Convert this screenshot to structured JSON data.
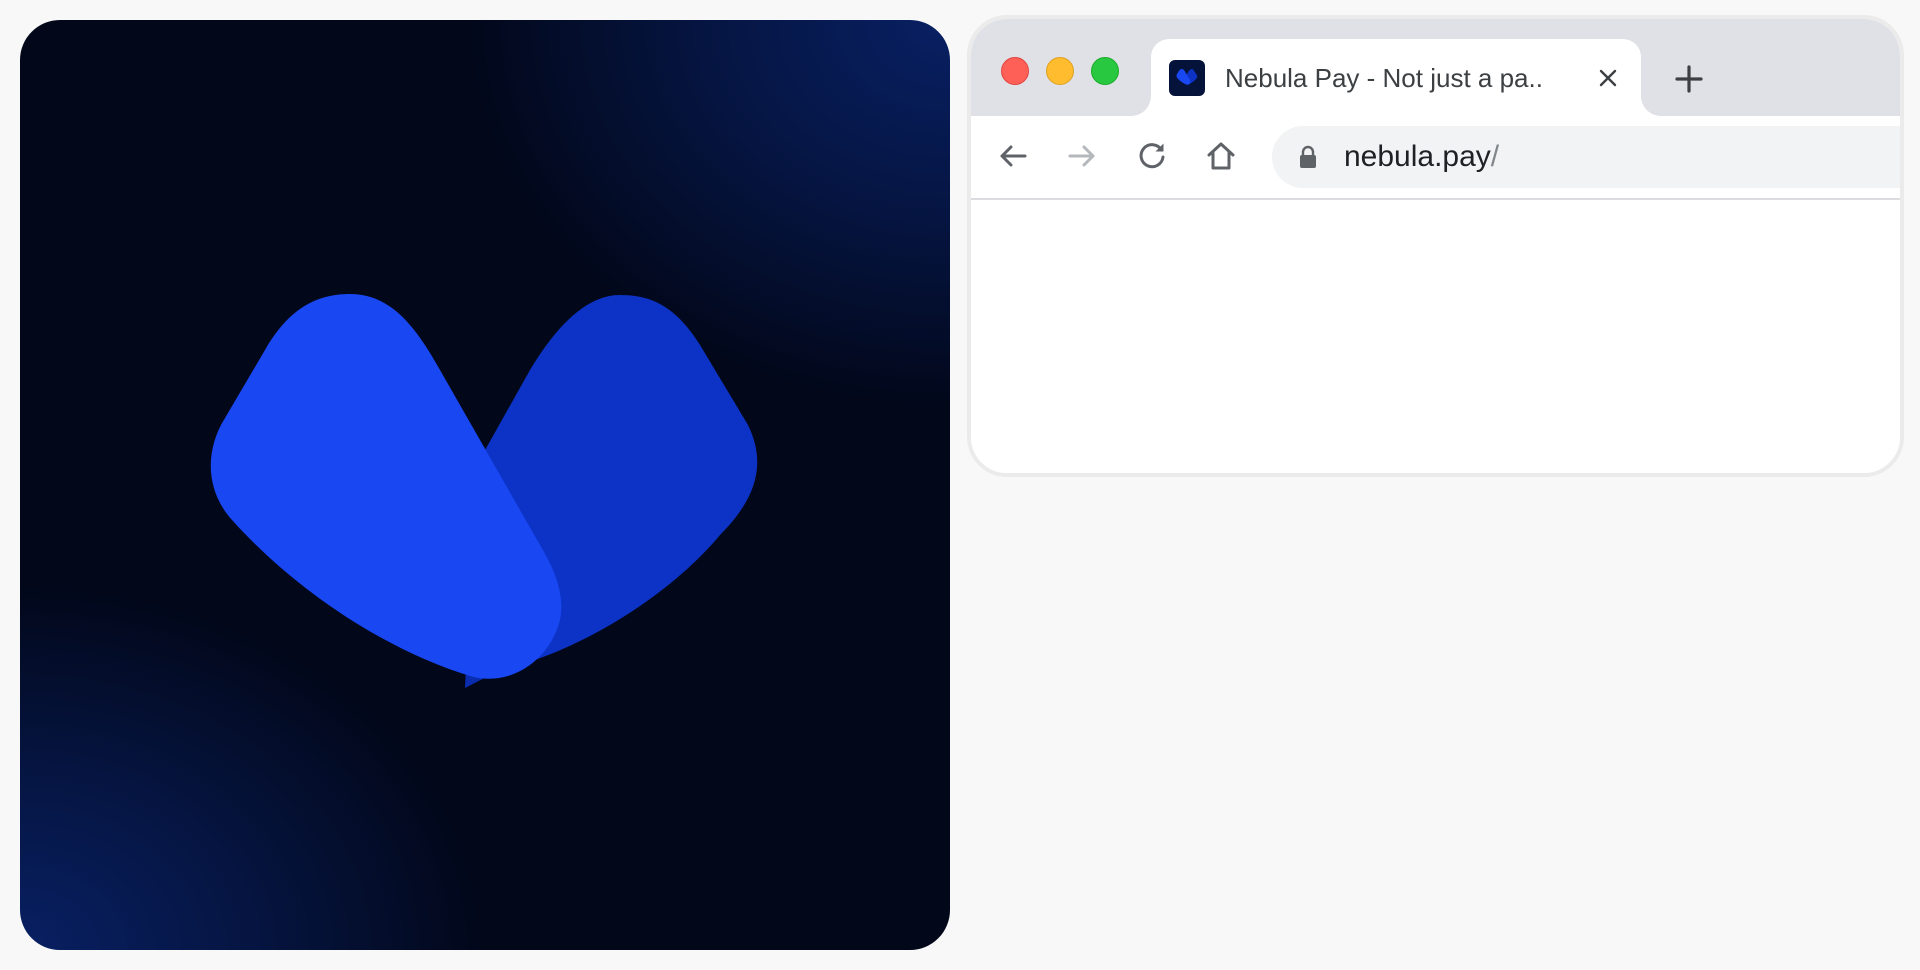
{
  "logo": {
    "name": "nebula-logo",
    "colors": {
      "background": "#020719",
      "background_glow": "#082063",
      "left_petal": "#1947f2",
      "right_petal": "#0c33c6"
    }
  },
  "browser": {
    "tab": {
      "title": "Nebula Pay - Not just a pa..",
      "favicon": "nebula-logo-icon",
      "close_icon": "close-icon"
    },
    "new_tab_icon": "plus-icon",
    "toolbar": {
      "back_icon": "arrow-left-icon",
      "forward_icon": "arrow-right-icon",
      "forward_enabled": false,
      "reload_icon": "reload-icon",
      "home_icon": "home-icon"
    },
    "address_bar": {
      "lock_icon": "lock-icon",
      "domain": "nebula.pay",
      "path": "/"
    }
  }
}
